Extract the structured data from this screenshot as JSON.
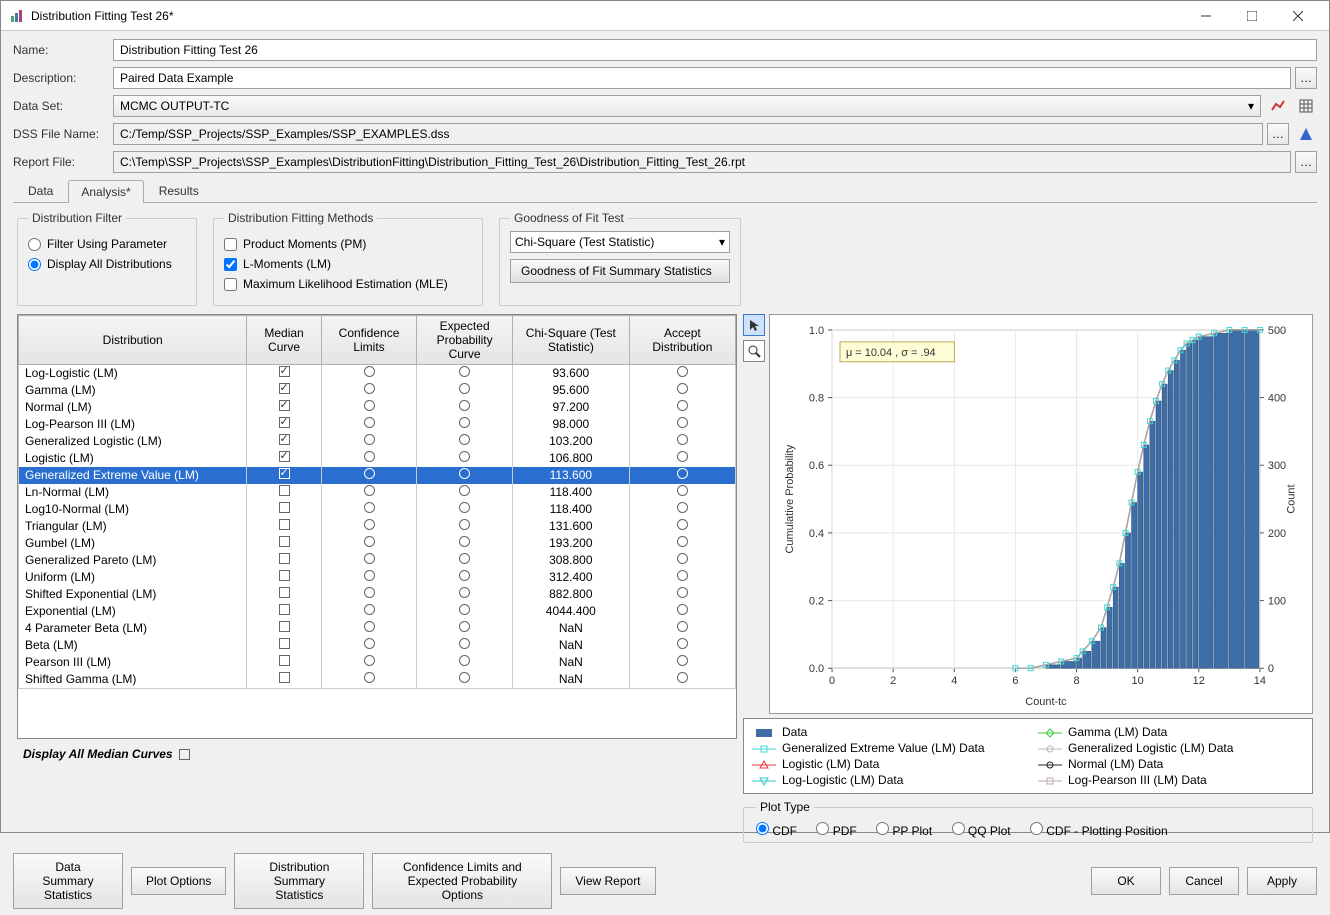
{
  "window": {
    "title": "Distribution Fitting Test 26*"
  },
  "form": {
    "name_label": "Name:",
    "name_value": "Distribution Fitting Test 26",
    "desc_label": "Description:",
    "desc_value": "Paired Data Example",
    "dataset_label": "Data Set:",
    "dataset_value": "MCMC OUTPUT-TC",
    "dss_label": "DSS File Name:",
    "dss_value": "C:/Temp/SSP_Projects/SSP_Examples/SSP_EXAMPLES.dss",
    "report_label": "Report File:",
    "report_value": "C:\\Temp\\SSP_Projects\\SSP_Examples\\DistributionFitting\\Distribution_Fitting_Test_26\\Distribution_Fitting_Test_26.rpt"
  },
  "tabs": {
    "data": "Data",
    "analysis": "Analysis*",
    "results": "Results"
  },
  "filter_box": {
    "title": "Distribution Filter",
    "opt_param": "Filter Using Parameter",
    "opt_all": "Display All Distributions"
  },
  "methods_box": {
    "title": "Distribution Fitting Methods",
    "pm": "Product Moments (PM)",
    "lm": "L-Moments (LM)",
    "mle": "Maximum Likelihood Estimation (MLE)"
  },
  "gof_box": {
    "title": "Goodness of Fit Test",
    "select_value": "Chi-Square (Test Statistic)",
    "summary_btn": "Goodness of Fit Summary Statistics"
  },
  "table": {
    "headers": {
      "dist": "Distribution",
      "median": "Median Curve",
      "conf": "Confidence Limits",
      "expected": "Expected Probability Curve",
      "chi": "Chi-Square (Test Statistic)",
      "accept": "Accept Distribution"
    },
    "rows": [
      {
        "name": "Log-Logistic (LM)",
        "median": true,
        "chi": "93.600",
        "sel": false
      },
      {
        "name": "Gamma (LM)",
        "median": true,
        "chi": "95.600",
        "sel": false
      },
      {
        "name": "Normal (LM)",
        "median": true,
        "chi": "97.200",
        "sel": false
      },
      {
        "name": "Log-Pearson III (LM)",
        "median": true,
        "chi": "98.000",
        "sel": false
      },
      {
        "name": "Generalized Logistic (LM)",
        "median": true,
        "chi": "103.200",
        "sel": false
      },
      {
        "name": "Logistic (LM)",
        "median": true,
        "chi": "106.800",
        "sel": false
      },
      {
        "name": "Generalized Extreme Value (LM)",
        "median": true,
        "chi": "113.600",
        "sel": true
      },
      {
        "name": "Ln-Normal (LM)",
        "median": false,
        "chi": "118.400",
        "sel": false
      },
      {
        "name": "Log10-Normal (LM)",
        "median": false,
        "chi": "118.400",
        "sel": false
      },
      {
        "name": "Triangular (LM)",
        "median": false,
        "chi": "131.600",
        "sel": false
      },
      {
        "name": "Gumbel (LM)",
        "median": false,
        "chi": "193.200",
        "sel": false
      },
      {
        "name": "Generalized Pareto (LM)",
        "median": false,
        "chi": "308.800",
        "sel": false
      },
      {
        "name": "Uniform (LM)",
        "median": false,
        "chi": "312.400",
        "sel": false
      },
      {
        "name": "Shifted Exponential (LM)",
        "median": false,
        "chi": "882.800",
        "sel": false
      },
      {
        "name": "Exponential (LM)",
        "median": false,
        "chi": "4044.400",
        "sel": false
      },
      {
        "name": "4 Parameter Beta (LM)",
        "median": false,
        "chi": "NaN",
        "sel": false
      },
      {
        "name": "Beta (LM)",
        "median": false,
        "chi": "NaN",
        "sel": false
      },
      {
        "name": "Pearson III (LM)",
        "median": false,
        "chi": "NaN",
        "sel": false
      },
      {
        "name": "Shifted Gamma (LM)",
        "median": false,
        "chi": "NaN",
        "sel": false
      }
    ]
  },
  "display_all_median": "Display All Median Curves",
  "buttons": {
    "data_summary": "Data Summary Statistics",
    "plot_options": "Plot Options",
    "dist_summary": "Distribution Summary Statistics",
    "conf_exp": "Confidence Limits and Expected Probability Options",
    "view_report": "View Report",
    "ok": "OK",
    "cancel": "Cancel",
    "apply": "Apply"
  },
  "chart": {
    "annotation": "μ = 10.04 , σ = .94",
    "xlabel": "Count-tc",
    "ylabel_left": "Cumulative Probability",
    "ylabel_right": "Count",
    "x_ticks": [
      "0",
      "2",
      "4",
      "6",
      "8",
      "10",
      "12",
      "14"
    ],
    "yl_ticks": [
      "0.0",
      "0.2",
      "0.4",
      "0.6",
      "0.8",
      "1.0"
    ],
    "yr_ticks": [
      "0",
      "100",
      "200",
      "300",
      "400",
      "500"
    ]
  },
  "legend": {
    "items": [
      {
        "label": "Data",
        "type": "bar",
        "color": "#3e6ea5"
      },
      {
        "label": "Gamma (LM) Data",
        "type": "diamond",
        "color": "#3ccf3c"
      },
      {
        "label": "Generalized Extreme Value (LM) Data",
        "type": "square",
        "color": "#40d8d8"
      },
      {
        "label": "Generalized Logistic (LM) Data",
        "type": "circle",
        "color": "#b8b8b8"
      },
      {
        "label": "Logistic (LM) Data",
        "type": "triup",
        "color": "#e83a3a"
      },
      {
        "label": "Normal (LM) Data",
        "type": "circle",
        "color": "#222222"
      },
      {
        "label": "Log-Logistic (LM) Data",
        "type": "tridown",
        "color": "#32c8c8"
      },
      {
        "label": "Log-Pearson III (LM) Data",
        "type": "square",
        "color": "#c4a8a8"
      }
    ]
  },
  "plot_type": {
    "title": "Plot Type",
    "cdf": "CDF",
    "pdf": "PDF",
    "pp": "PP Plot",
    "qq": "QQ Plot",
    "cdfpp": "CDF - Plotting Position"
  },
  "chart_data": {
    "type": "bar",
    "title": "",
    "xlabel": "Count-tc",
    "ylabel": "Cumulative Probability",
    "xlim": [
      0,
      14
    ],
    "ylim_left": [
      0,
      1.0
    ],
    "ylim_right": [
      0,
      500
    ],
    "annotation": "μ = 10.04 , σ = .94",
    "cdf_points": [
      {
        "x": 6.0,
        "y": 0.0
      },
      {
        "x": 6.5,
        "y": 0.0
      },
      {
        "x": 7.0,
        "y": 0.01
      },
      {
        "x": 7.5,
        "y": 0.02
      },
      {
        "x": 8.0,
        "y": 0.03
      },
      {
        "x": 8.2,
        "y": 0.05
      },
      {
        "x": 8.5,
        "y": 0.08
      },
      {
        "x": 8.8,
        "y": 0.12
      },
      {
        "x": 9.0,
        "y": 0.18
      },
      {
        "x": 9.2,
        "y": 0.24
      },
      {
        "x": 9.4,
        "y": 0.31
      },
      {
        "x": 9.6,
        "y": 0.4
      },
      {
        "x": 9.8,
        "y": 0.49
      },
      {
        "x": 10.0,
        "y": 0.58
      },
      {
        "x": 10.2,
        "y": 0.66
      },
      {
        "x": 10.4,
        "y": 0.73
      },
      {
        "x": 10.6,
        "y": 0.79
      },
      {
        "x": 10.8,
        "y": 0.84
      },
      {
        "x": 11.0,
        "y": 0.88
      },
      {
        "x": 11.2,
        "y": 0.91
      },
      {
        "x": 11.4,
        "y": 0.94
      },
      {
        "x": 11.6,
        "y": 0.96
      },
      {
        "x": 11.8,
        "y": 0.97
      },
      {
        "x": 12.0,
        "y": 0.98
      },
      {
        "x": 12.5,
        "y": 0.99
      },
      {
        "x": 13.0,
        "y": 1.0
      },
      {
        "x": 13.5,
        "y": 1.0
      },
      {
        "x": 14.0,
        "y": 1.0
      }
    ],
    "series": [
      {
        "name": "Data (CDF bars)",
        "type": "bar"
      },
      {
        "name": "Gamma (LM)",
        "type": "line"
      },
      {
        "name": "Generalized Extreme Value (LM)",
        "type": "line"
      },
      {
        "name": "Generalized Logistic (LM)",
        "type": "line"
      },
      {
        "name": "Logistic (LM)",
        "type": "line"
      },
      {
        "name": "Normal (LM)",
        "type": "line"
      },
      {
        "name": "Log-Logistic (LM)",
        "type": "line"
      },
      {
        "name": "Log-Pearson III (LM)",
        "type": "line"
      }
    ]
  }
}
